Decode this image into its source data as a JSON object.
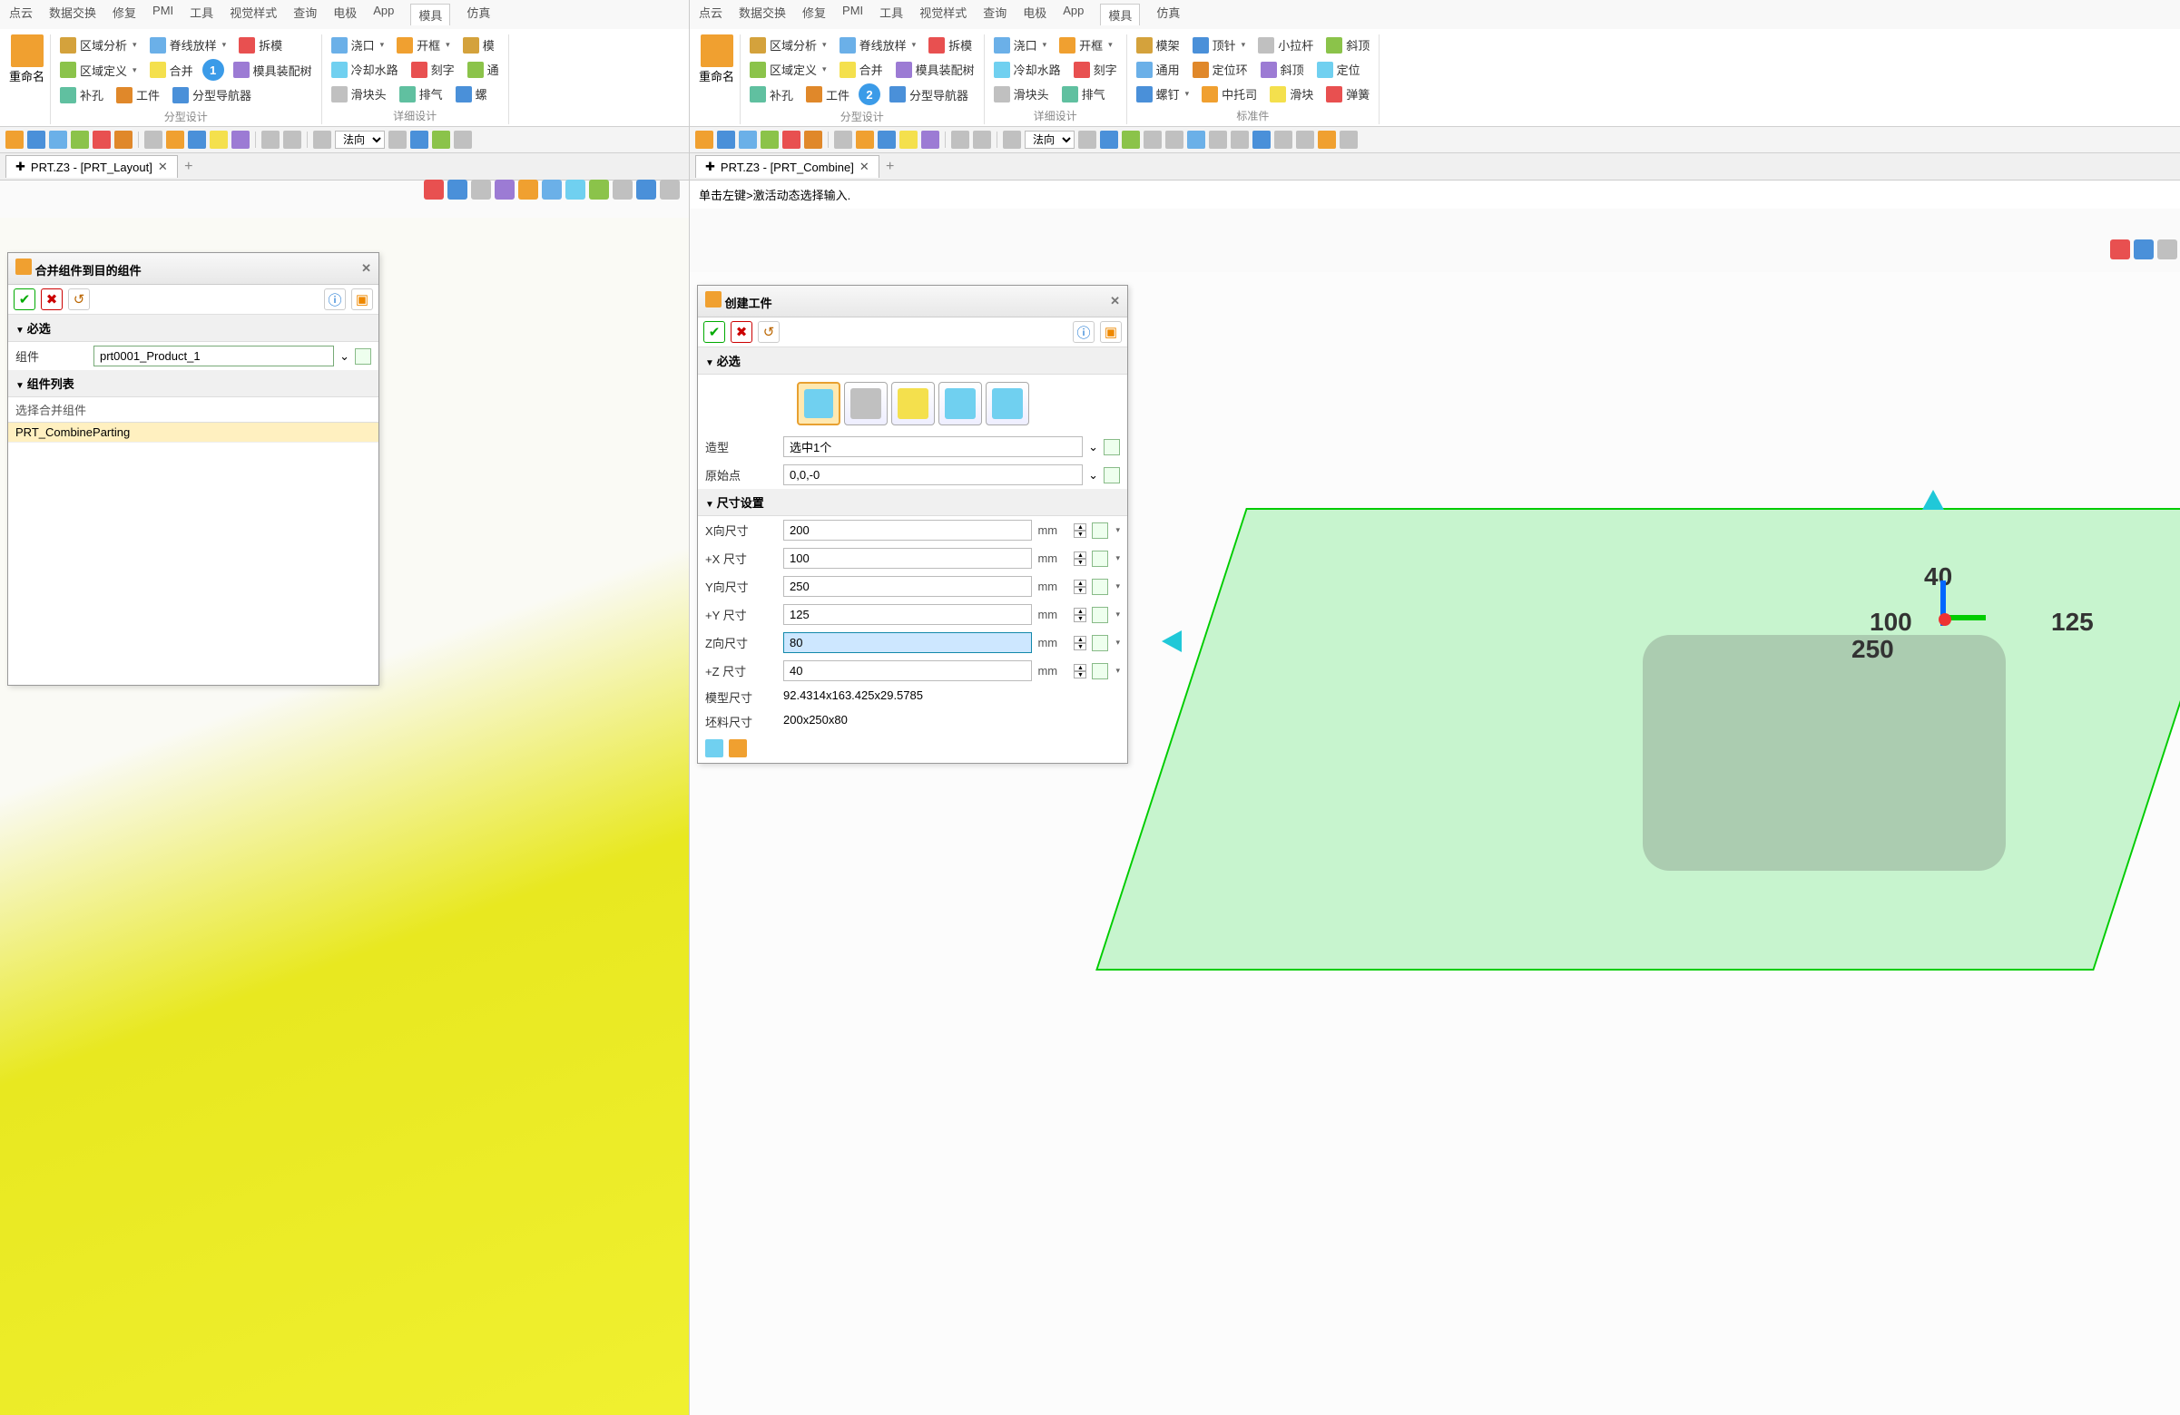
{
  "menu": {
    "items": [
      "点云",
      "数据交换",
      "修复",
      "PMI",
      "工具",
      "视觉样式",
      "查询",
      "电极",
      "App"
    ],
    "active": "模具",
    "after": [
      "仿真"
    ]
  },
  "ribbon": {
    "rename": "重命名",
    "groups": {
      "parting": {
        "label": "分型设计",
        "buttons": [
          "区域分析",
          "脊线放样",
          "拆模",
          "区域定义",
          "合并",
          "模具装配树",
          "补孔",
          "工件",
          "分型导航器"
        ]
      },
      "detail": {
        "label": "详细设计",
        "buttons": [
          "浇口",
          "开框",
          "冷却水路",
          "刻字",
          "滑块头",
          "排气"
        ]
      },
      "standard": {
        "label": "标准件",
        "buttons": [
          "模架",
          "顶针",
          "小拉杆",
          "斜顶",
          "通用",
          "定位环",
          "斜顶",
          "定位",
          "螺钉",
          "中托司",
          "滑块",
          "弹簧"
        ]
      }
    }
  },
  "toolbar": {
    "direction_label": "法向"
  },
  "left": {
    "tab": "PRT.Z3 - [PRT_Layout]",
    "panel": {
      "title": "合并组件到目的组件",
      "section_required": "必选",
      "field_component": "组件",
      "component_value": "prt0001_Product_1",
      "section_list": "组件列表",
      "list_hint": "选择合并组件",
      "list_item": "PRT_CombineParting"
    },
    "step": "1"
  },
  "right": {
    "tab": "PRT.Z3 - [PRT_Combine]",
    "status": "单击左键>激活动态选择输入.",
    "panel": {
      "title": "创建工件",
      "section_required": "必选",
      "field_shape": "造型",
      "shape_value": "选中1个",
      "field_origin": "原始点",
      "origin_value": "0,0,-0",
      "section_dims": "尺寸设置",
      "fields": {
        "x": {
          "label": "X向尺寸",
          "value": "200",
          "unit": "mm"
        },
        "px": {
          "label": "+X 尺寸",
          "value": "100",
          "unit": "mm"
        },
        "y": {
          "label": "Y向尺寸",
          "value": "250",
          "unit": "mm"
        },
        "py": {
          "label": "+Y 尺寸",
          "value": "125",
          "unit": "mm"
        },
        "z": {
          "label": "Z向尺寸",
          "value": "80",
          "unit": "mm"
        },
        "pz": {
          "label": "+Z 尺寸",
          "value": "40",
          "unit": "mm"
        }
      },
      "model_size_label": "模型尺寸",
      "model_size_value": "92.4314x163.425x29.5785",
      "stock_size_label": "坯料尺寸",
      "stock_size_value": "200x250x80"
    },
    "annotations": {
      "a40": "40",
      "a100": "100",
      "a250": "250",
      "a125": "125"
    },
    "step": "2"
  }
}
